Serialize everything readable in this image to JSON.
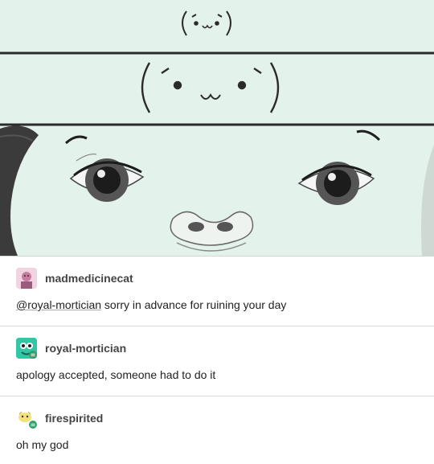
{
  "image": {
    "kind": "sketch",
    "emoticon_top": "(´･ω･`)",
    "colors": {
      "background": "#e4f2ec",
      "ink": "#2b2b2b"
    }
  },
  "replies": [
    {
      "username": "madmedicinecat",
      "mention": "@royal-mortician",
      "text": " sorry in advance for ruining your day",
      "avatar_icon": "pink-portrait-avatar-icon"
    },
    {
      "username": "royal-mortician",
      "mention": "",
      "text": "apology accepted, someone had to do it",
      "avatar_icon": "green-monster-avatar-icon"
    },
    {
      "username": "firespirited",
      "mention": "",
      "text": "oh my god",
      "avatar_icon": "yellow-creature-avatar-icon"
    }
  ]
}
